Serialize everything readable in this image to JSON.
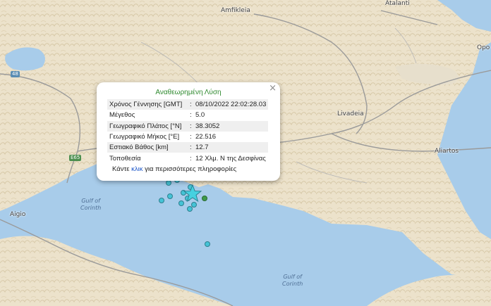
{
  "map": {
    "places": [
      "Amfikleia",
      "Atalanti",
      "Opo",
      "Livadeia",
      "Aliartos",
      "Aigio"
    ],
    "sea_labels": [
      "Gulf of\nCorinth",
      "Gulf of\nCorinth"
    ],
    "road_shields": [
      "48",
      "E65"
    ],
    "colors": {
      "land": "#ece2cb",
      "relief": "#cdbc97",
      "water": "#a8ccea",
      "roads": "#9a9a9a",
      "marker": "#45c3d6"
    }
  },
  "popup": {
    "close_glyph": "×",
    "title": "Αναθεωρημένη Λύση",
    "rows": [
      {
        "label": "Χρόνος Γέννησης [GMT]",
        "sep": ":",
        "value": "08/10/2022 22:02:28.03"
      },
      {
        "label": "Μέγεθος",
        "sep": ":",
        "value": "5.0"
      },
      {
        "label": "Γεωγραφικό Πλάτος [°N]",
        "sep": ":",
        "value": "38.3052"
      },
      {
        "label": "Γεωγραφικό Μήκος [°E]",
        "sep": ":",
        "value": "22.516"
      },
      {
        "label": "Εστιακό Βάθος [km]",
        "sep": ":",
        "value": "12.7"
      },
      {
        "label": "Τοποθεσία",
        "sep": ":",
        "value": "12 Χλμ. Ν της Δεσφίνας"
      }
    ],
    "more_prefix": "Κάντε",
    "more_link": "κλικ",
    "more_suffix": "για περισσότερες πληροφορίες"
  },
  "epicenter_icon": "star-icon"
}
